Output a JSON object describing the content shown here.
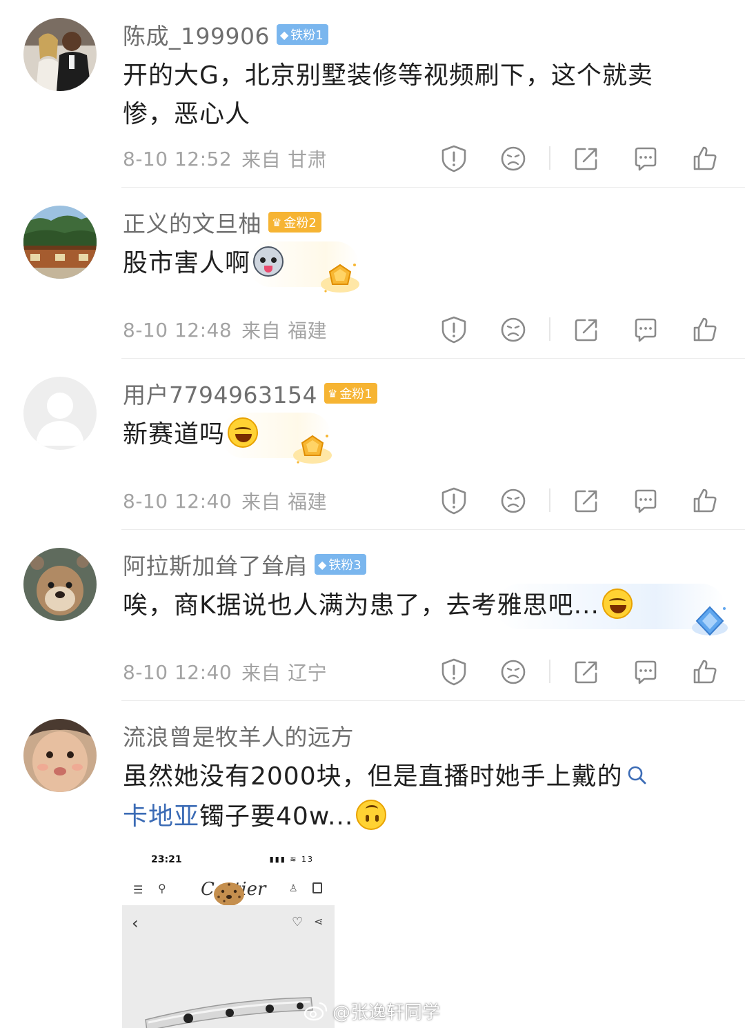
{
  "comments": [
    {
      "username": "陈成_199906",
      "badge": "铁粉1",
      "badge_type": "iron",
      "line1": "开的大G，北京别墅装修等视频刷下，这个就卖",
      "line2": "惨，恶心人",
      "time": "8-10 12:52",
      "from": "来自",
      "location": "甘肃"
    },
    {
      "username": "正义的文旦柚",
      "badge": "金粉2",
      "badge_type": "gold",
      "line1": "股市害人啊",
      "time": "8-10 12:48",
      "from": "来自",
      "location": "福建"
    },
    {
      "username": "用户7794963154",
      "badge": "金粉1",
      "badge_type": "gold",
      "line1": "新赛道吗",
      "time": "8-10 12:40",
      "from": "来自",
      "location": "福建"
    },
    {
      "username": "阿拉斯加耸了耸肩",
      "badge": "铁粉3",
      "badge_type": "iron",
      "line1": "唉，商K据说也人满为患了，去考雅思吧...",
      "time": "8-10 12:40",
      "from": "来自",
      "location": "辽宁"
    },
    {
      "username": "流浪曾是牧羊人的远方",
      "line1": "虽然她没有2000块，但是直播时她手上戴的",
      "link": "卡地亚",
      "line2_rest": "镯子要40w..."
    }
  ],
  "embedded_screenshot": {
    "time": "23:21",
    "status_icons": "▮▮▮ ≋ 13",
    "brand": "Cartier"
  },
  "watermark": "@张逸轩同学",
  "colors": {
    "iron_badge": "#7ab6ee",
    "gold_badge": "#f6b433",
    "link": "#3b6bb5",
    "meta_text": "#a3a3a3"
  },
  "action_icons": [
    "report-icon",
    "dislike-face-icon",
    "share-icon",
    "comment-icon",
    "like-icon"
  ]
}
